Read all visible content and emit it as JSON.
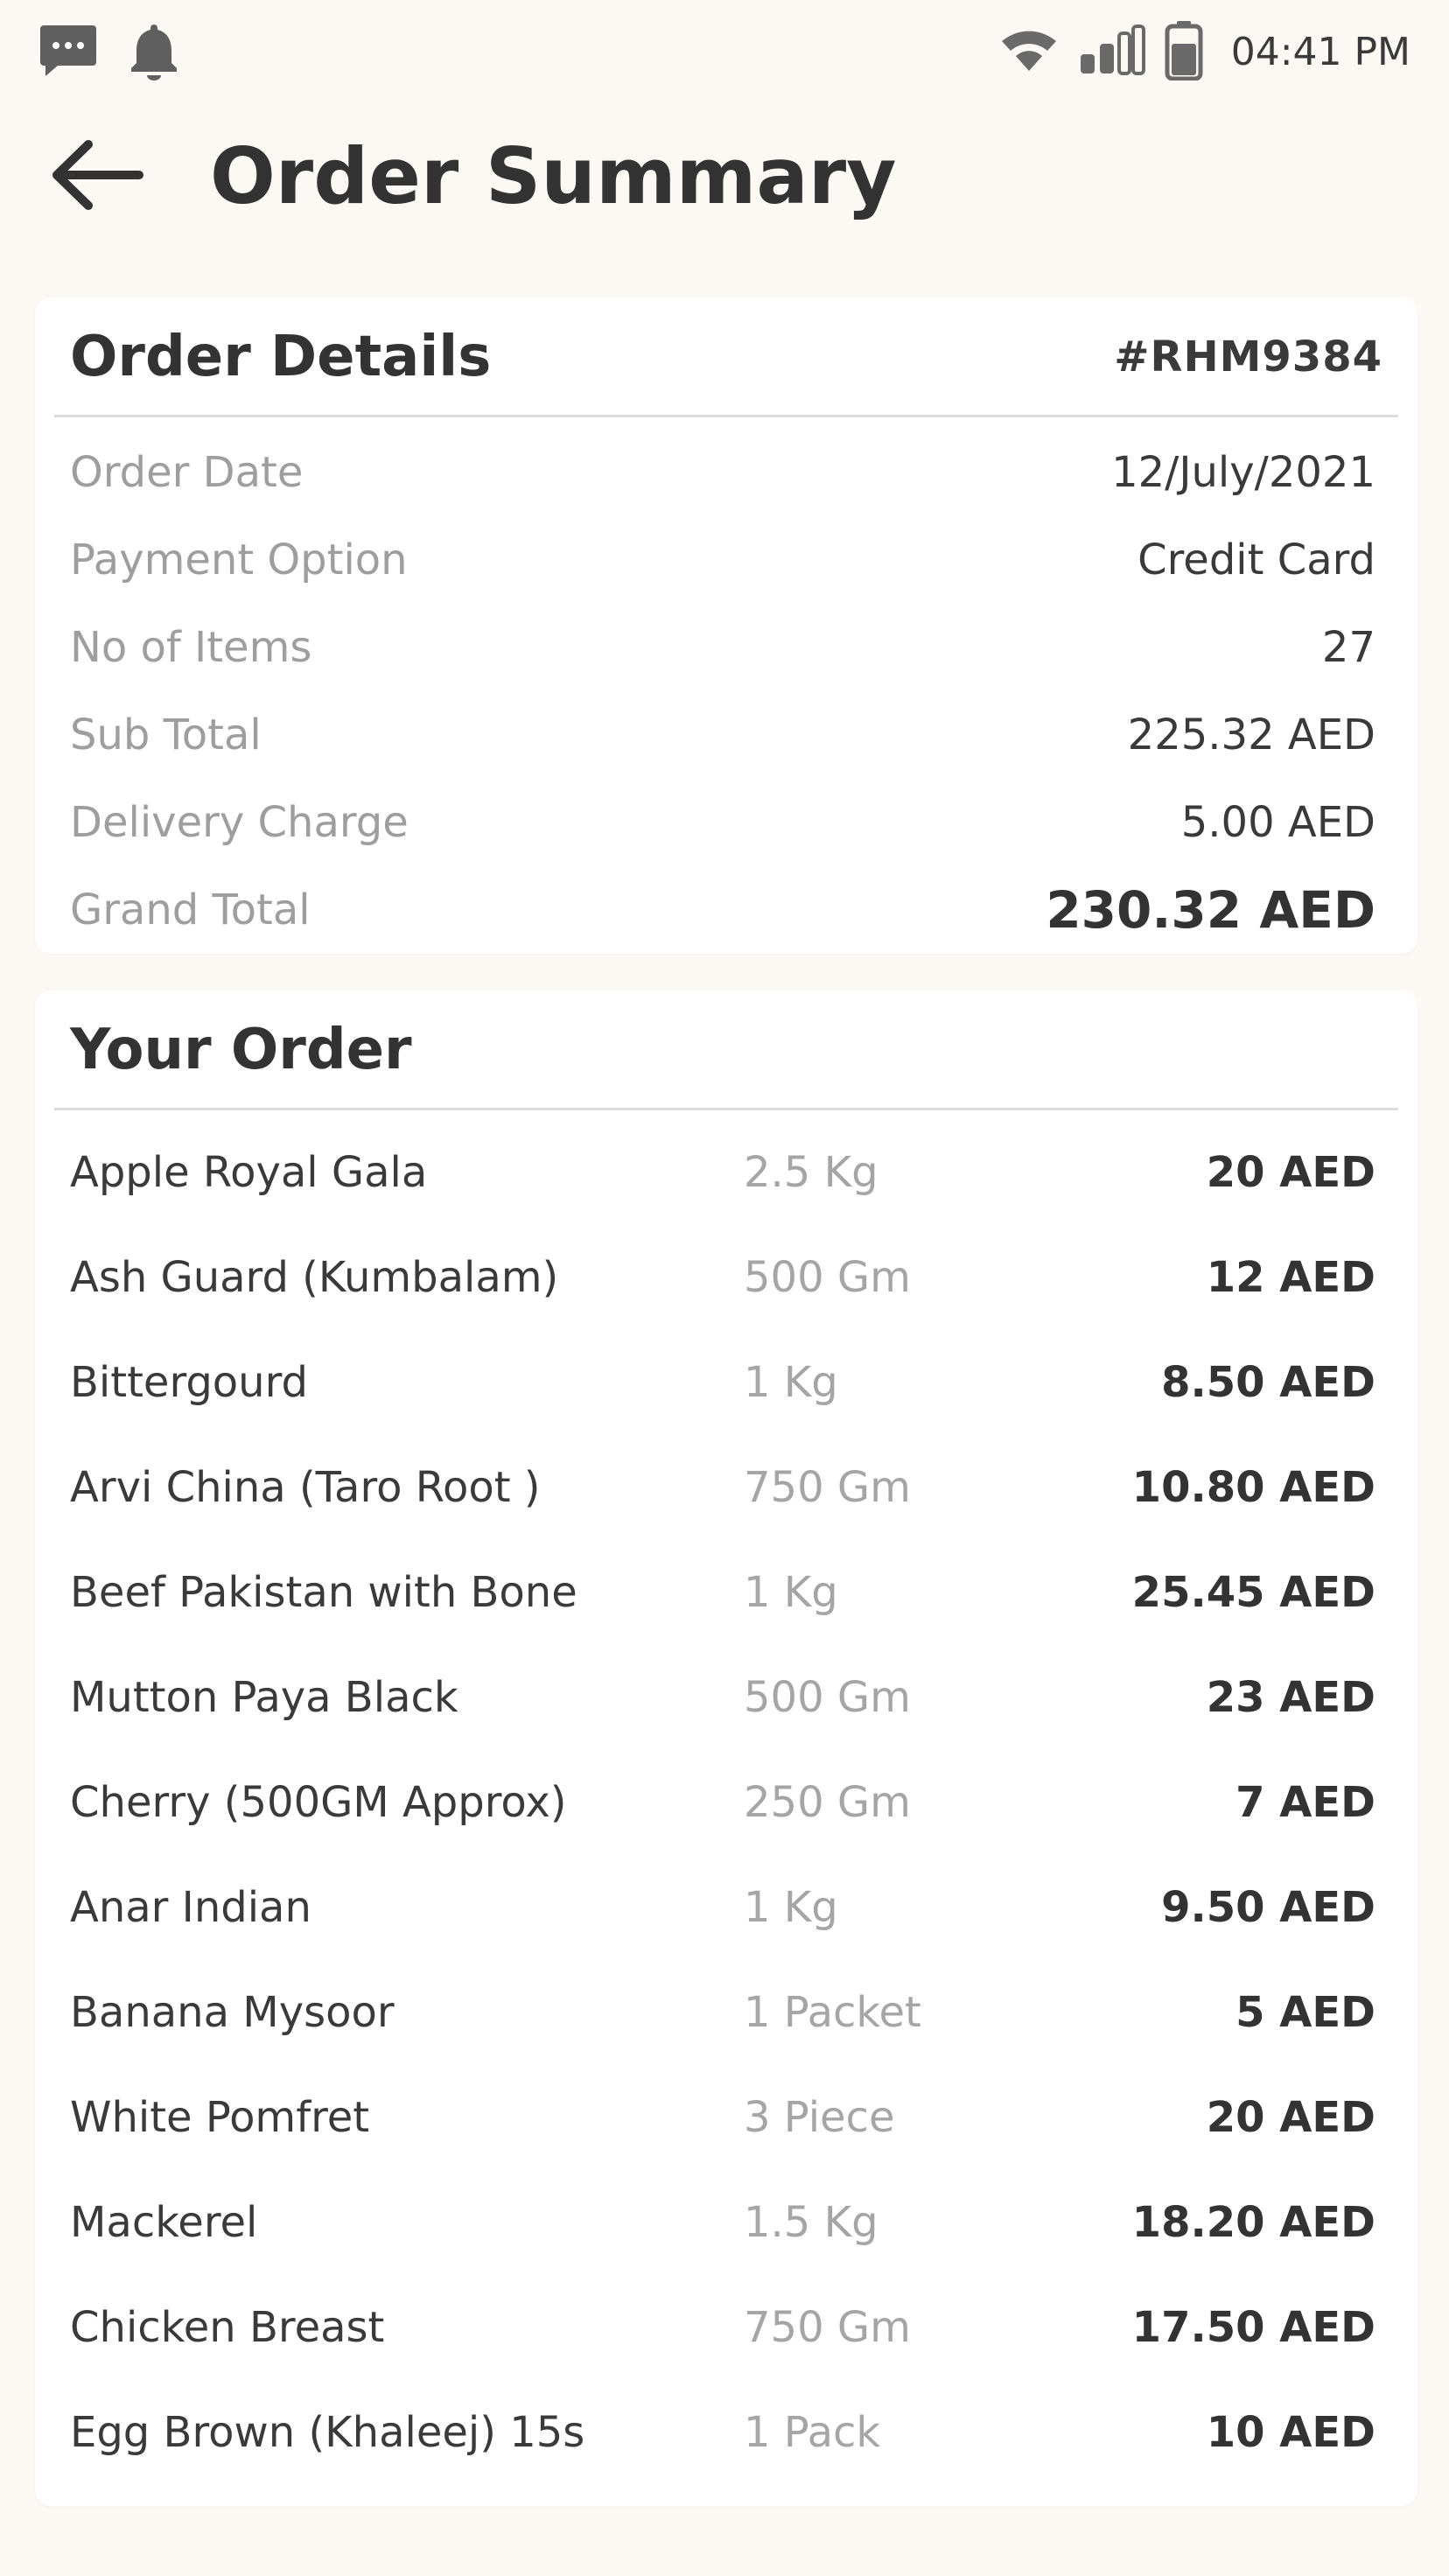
{
  "status_bar": {
    "time": "04:41 PM",
    "icons": [
      "message-icon",
      "bell-icon",
      "wifi-icon",
      "signal-icon",
      "battery-icon"
    ]
  },
  "header": {
    "title": "Order Summary",
    "back_icon": "arrow-left-icon"
  },
  "order_details": {
    "heading": "Order Details",
    "order_number": "#RHM9384",
    "rows": [
      {
        "label": "Order Date",
        "value": "12/July/2021"
      },
      {
        "label": "Payment Option",
        "value": "Credit Card"
      },
      {
        "label": "No of Items",
        "value": "27"
      },
      {
        "label": "Sub Total",
        "value": "225.32 AED"
      },
      {
        "label": "Delivery Charge",
        "value": "5.00 AED"
      },
      {
        "label": "Grand Total",
        "value": "230.32 AED"
      }
    ]
  },
  "your_order": {
    "heading": "Your Order",
    "items": [
      {
        "name": "Apple Royal Gala",
        "qty": "2.5 Kg",
        "price": "20 AED"
      },
      {
        "name": "Ash Guard (Kumbalam)",
        "qty": "500 Gm",
        "price": "12 AED"
      },
      {
        "name": "Bittergourd",
        "qty": "1 Kg",
        "price": "8.50 AED"
      },
      {
        "name": "Arvi China (Taro Root )",
        "qty": "750 Gm",
        "price": "10.80 AED"
      },
      {
        "name": "Beef Pakistan with Bone",
        "qty": "1 Kg",
        "price": "25.45 AED"
      },
      {
        "name": "Mutton Paya Black",
        "qty": "500 Gm",
        "price": "23 AED"
      },
      {
        "name": "Cherry (500GM Approx)",
        "qty": "250 Gm",
        "price": "7 AED"
      },
      {
        "name": "Anar Indian",
        "qty": "1 Kg",
        "price": "9.50 AED"
      },
      {
        "name": "Banana Mysoor",
        "qty": "1 Packet",
        "price": "5 AED"
      },
      {
        "name": "White Pomfret",
        "qty": "3 Piece",
        "price": "20 AED"
      },
      {
        "name": "Mackerel",
        "qty": "1.5 Kg",
        "price": "18.20 AED"
      },
      {
        "name": "Chicken Breast",
        "qty": "750 Gm",
        "price": "17.50 AED"
      },
      {
        "name": "Egg Brown (Khaleej) 15s",
        "qty": "1 Pack",
        "price": "10 AED"
      }
    ]
  },
  "colors": {
    "background": "#fcf9f5",
    "card": "#ffffff",
    "text_primary": "#333333",
    "text_muted": "#9e9e9e"
  }
}
